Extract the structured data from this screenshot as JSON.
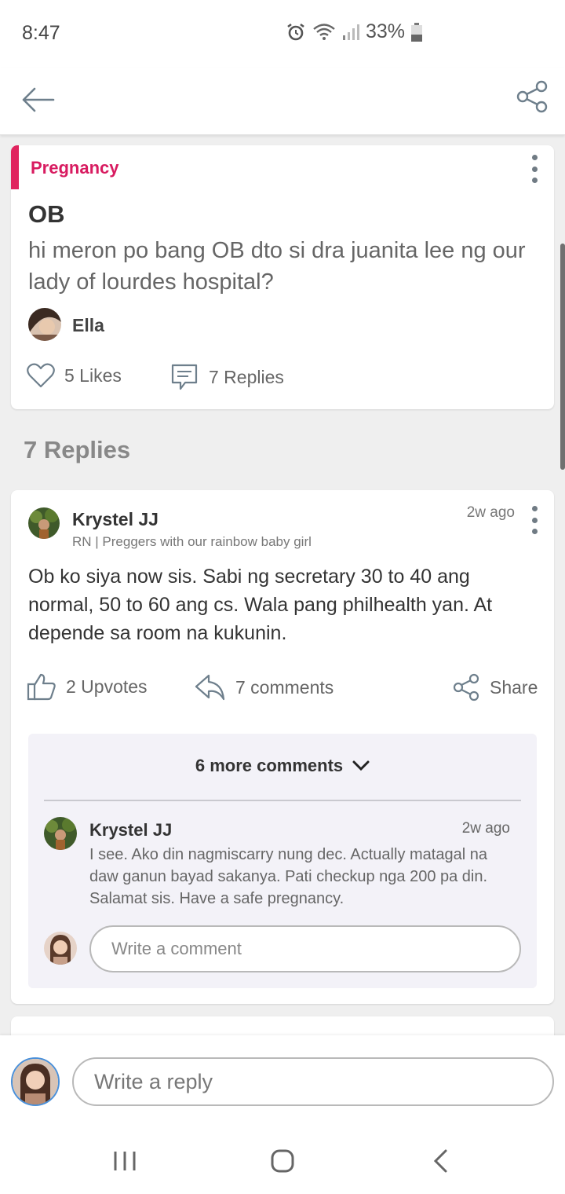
{
  "status": {
    "time": "8:47",
    "battery": "33%"
  },
  "post": {
    "category": "Pregnancy",
    "title": "OB",
    "body": "hi meron po bang OB dto si dra juanita lee ng our lady of lourdes hospital?",
    "author": "Ella",
    "likes": "5 Likes",
    "replies": "7 Replies"
  },
  "replies_heading": "7 Replies",
  "reply": {
    "name": "Krystel JJ",
    "subtitle": "RN | Preggers with our rainbow baby girl",
    "time": "2w ago",
    "body": "Ob ko siya now sis. Sabi ng secretary 30 to 40 ang normal, 50 to 60 ang cs. Wala pang philhealth yan. At depende sa room na kukunin.",
    "upvotes": "2 Upvotes",
    "comments": "7 comments",
    "share": "Share",
    "more_comments": "6 more comments",
    "comment": {
      "name": "Krystel JJ",
      "time": "2w ago",
      "text": "I see. Ako din nagmiscarry nung dec. Actually matagal na daw ganun bayad sakanya. Pati checkup nga 200 pa din. Salamat sis. Have a safe pregnancy."
    },
    "comment_placeholder": "Write a comment"
  },
  "reply_placeholder": "Write a reply",
  "colors": {
    "accent": "#d81b60",
    "icon": "#6e7f8c"
  }
}
